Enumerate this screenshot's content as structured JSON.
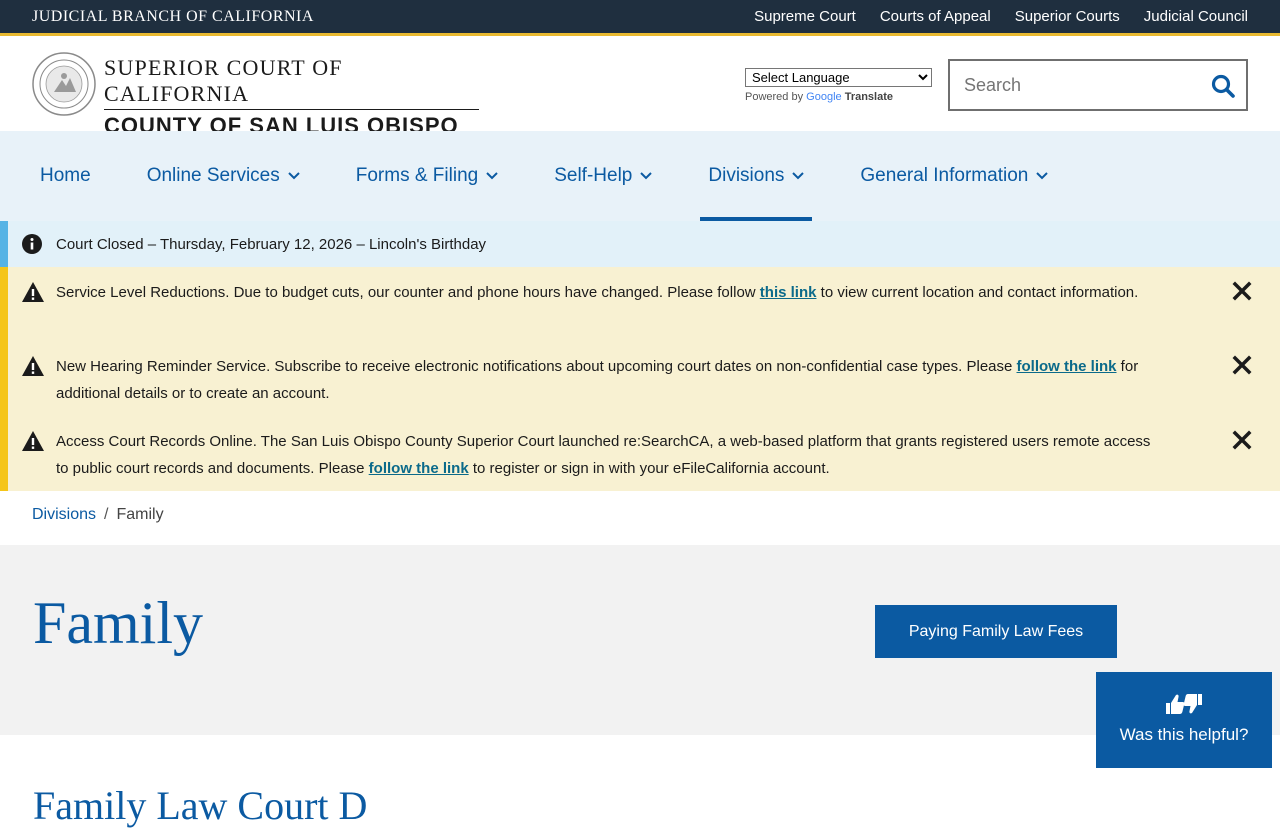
{
  "topbar": {
    "branch": "JUDICIAL BRANCH OF CALIFORNIA",
    "links": [
      "Supreme Court",
      "Courts of Appeal",
      "Superior Courts",
      "Judicial Council"
    ]
  },
  "header": {
    "line1": "SUPERIOR COURT OF CALIFORNIA",
    "line2": "COUNTY OF SAN LUIS OBISPO",
    "translate_select": "Select Language",
    "powered_by": "Powered by",
    "google": "Google",
    "translate": "Translate",
    "search_placeholder": "Search"
  },
  "nav": {
    "items": [
      {
        "label": "Home"
      },
      {
        "label": "Online Services"
      },
      {
        "label": "Forms & Filing"
      },
      {
        "label": "Self-Help"
      },
      {
        "label": "Divisions"
      },
      {
        "label": "General Information"
      }
    ]
  },
  "alerts": {
    "info": "Court Closed – Thursday, February 12, 2026 – Lincoln's Birthday",
    "warnings": [
      {
        "before": "Service Level Reductions. Due to budget cuts, our counter and phone hours have changed. Please follow ",
        "link": "this link",
        "after": " to view current location and contact information."
      },
      {
        "before": "New Hearing Reminder Service. Subscribe to receive electronic notifications about upcoming court dates on non-confidential case types. Please ",
        "link": "follow the link",
        "after": " for additional details or to create an account."
      },
      {
        "before": "Access Court Records Online. The San Luis Obispo County Superior Court launched re:SearchCA, a web-based platform that grants registered users remote access to public court records and documents. Please ",
        "link": "follow the link",
        "after": " to register or sign in with your eFileCalifornia account."
      }
    ]
  },
  "breadcrumb": {
    "parent": "Divisions",
    "current": "Family"
  },
  "hero": {
    "title": "Family",
    "button": "Paying Family Law Fees"
  },
  "section": {
    "heading": "Family Law Court D"
  },
  "helpful": {
    "label": "Was this helpful?"
  },
  "colors": {
    "brand": "#0b5aa2",
    "topbar": "#1f2f3f",
    "accent": "#e8b930",
    "warning": "#f5c518",
    "info": "#56b3e5"
  }
}
